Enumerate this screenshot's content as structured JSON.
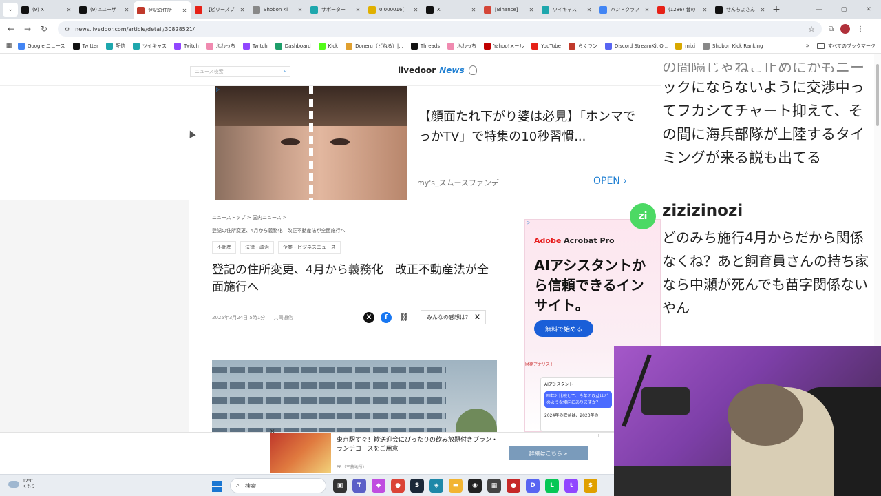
{
  "tabs": [
    {
      "title": "(9) X",
      "icon": "x-icon",
      "color": "#111111",
      "active": false
    },
    {
      "title": "(9) Xユーザ",
      "icon": "x-icon",
      "color": "#111111",
      "active": false
    },
    {
      "title": "登記の住所",
      "icon": "livedoor-icon",
      "color": "#c0392b",
      "active": true
    },
    {
      "title": "【ピリーズブ",
      "icon": "youtube-icon",
      "color": "#e62117",
      "active": false
    },
    {
      "title": "Shobon Ki",
      "icon": "shobon-icon",
      "color": "#888888",
      "active": false
    },
    {
      "title": "サポーター",
      "icon": "twitcasting-icon",
      "color": "#1ea7ad",
      "active": false
    },
    {
      "title": "0.000016(",
      "icon": "coin-icon",
      "color": "#e0b000",
      "active": false
    },
    {
      "title": "X",
      "icon": "x-icon",
      "color": "#111111",
      "active": false
    },
    {
      "title": "[Binance]",
      "icon": "gmail-icon",
      "color": "#d44638",
      "active": false
    },
    {
      "title": "ツイキャス",
      "icon": "twitcasting-icon",
      "color": "#1ea7ad",
      "active": false
    },
    {
      "title": "ハンドクラフ",
      "icon": "google-icon",
      "color": "#4285f4",
      "active": false
    },
    {
      "title": "(1286) 昔の",
      "icon": "youtube-icon",
      "color": "#e62117",
      "active": false
    },
    {
      "title": "せんちょさん",
      "icon": "x-icon",
      "color": "#111111",
      "active": false
    }
  ],
  "toolbar": {
    "url": "news.livedoor.com/article/detail/30828521/"
  },
  "bookmarks": [
    {
      "label": "Google ニュース",
      "icon": "google-news-icon",
      "color": "#4285f4"
    },
    {
      "label": "Twitter",
      "icon": "x-icon",
      "color": "#111111"
    },
    {
      "label": "配信",
      "icon": "twitcasting-icon",
      "color": "#1ea7ad"
    },
    {
      "label": "ツイキャス",
      "icon": "twitcasting-icon",
      "color": "#1ea7ad"
    },
    {
      "label": "Twitch",
      "icon": "twitch-icon",
      "color": "#9146ff"
    },
    {
      "label": "ふわっち",
      "icon": "fuwacchi-icon",
      "color": "#f08ab0"
    },
    {
      "label": "Twitch",
      "icon": "twitch-icon",
      "color": "#9146ff"
    },
    {
      "label": "Dashboard",
      "icon": "dashboard-icon",
      "color": "#1e9e6a"
    },
    {
      "label": "Kick",
      "icon": "kick-icon",
      "color": "#53fc18"
    },
    {
      "label": "Doneru（どねる）|...",
      "icon": "doneru-icon",
      "color": "#e0a030"
    },
    {
      "label": "Threads",
      "icon": "threads-icon",
      "color": "#111111"
    },
    {
      "label": "ふわっち",
      "icon": "fuwacchi-icon",
      "color": "#f08ab0"
    },
    {
      "label": "Yahoo!メール",
      "icon": "yahoo-icon",
      "color": "#c00000"
    },
    {
      "label": "YouTube",
      "icon": "youtube-icon",
      "color": "#e62117"
    },
    {
      "label": "らくラン",
      "icon": "rakuran-icon",
      "color": "#c0392b"
    },
    {
      "label": "Discord StreamKit O...",
      "icon": "discord-icon",
      "color": "#5865f2"
    },
    {
      "label": "mixi",
      "icon": "mixi-icon",
      "color": "#d8a800"
    },
    {
      "label": "Shobon Kick Ranking",
      "icon": "shobon-icon",
      "color": "#888888"
    }
  ],
  "bookmarks_all": "すべてのブックマーク",
  "site": {
    "search_placeholder": "ニュース検索",
    "logo_main": "livedoor",
    "logo_news": "News"
  },
  "top_ad": {
    "headline": "【顔面たれ下がり婆は必見】「ホンマでっかTV」で特集の10秒習慣...",
    "sponsor": "my's_スムースファンデ",
    "open": "OPEN ›"
  },
  "article": {
    "breadcrumb": "ニューストップ > 国内ニュース >",
    "breadcrumb_current": "登記の住所変更、4月から義務化　改正不動産法が全面施行へ",
    "tags": [
      "不動産",
      "法律・政治",
      "企業・ビジネスニュース"
    ],
    "title": "登記の住所変更、4月から義務化　改正不動産法が全面施行へ",
    "date": "2025年3月24日 5時1分",
    "source": "共同通信",
    "share_opinion": "みんなの感想は？"
  },
  "right_ad": {
    "brand_prefix": "Adobe",
    "brand_rest": " Acrobat Pro",
    "headline": "AIアシスタントから信頼できるインサイト。",
    "cta": "無料で始める",
    "analyst": "財務アナリスト",
    "mini_title": "AIアシスタント",
    "mini_bubble": "昨年と比較して、今年の収益はどのような傾向にありますか？",
    "mini_bottom": "2024年の収益は、2023年の"
  },
  "chat": {
    "cut_line": "の間隔じゃねこ止めにかもニー",
    "message1": "ックにならないように交渉中ってフカシてチャート抑えて、その間に海兵部隊が上陸するタイミングが来る説も出てる",
    "avatar_initials": "zi",
    "avatar_color": "#4cd964",
    "username": "zizizinozi",
    "message2": "どのみち施行4月からだから関係なくね？あと飼育員さんの持ち家なら中瀬が死んでも苗字関係ないやん"
  },
  "bottom_ad": {
    "text": "東京駅すぐ！歓送迎会にぴったりの飲み放題付きプラン・ランチコースをご用意",
    "pr": "PR（三菱地所）",
    "button": "詳細はこちら »"
  },
  "taskbar": {
    "temperature": "12°C",
    "weather": "くもり",
    "search_label": "検索",
    "apps": [
      {
        "name": "task-view-icon",
        "color": "#333333",
        "glyph": "▣"
      },
      {
        "name": "teams-icon",
        "color": "#5b5fc7",
        "glyph": "T"
      },
      {
        "name": "copilot-icon",
        "color": "#c04de0",
        "glyph": "◆"
      },
      {
        "name": "chrome-icon",
        "color": "#db4437",
        "glyph": "●"
      },
      {
        "name": "steam-icon",
        "color": "#1b2838",
        "glyph": "S"
      },
      {
        "name": "app-icon",
        "color": "#1e88a8",
        "glyph": "◈"
      },
      {
        "name": "folder-icon",
        "color": "#f2b431",
        "glyph": "▬"
      },
      {
        "name": "obs-icon",
        "color": "#222222",
        "glyph": "◉"
      },
      {
        "name": "calculator-icon",
        "color": "#444444",
        "glyph": "▦"
      },
      {
        "name": "record-icon",
        "color": "#c62828",
        "glyph": "●"
      },
      {
        "name": "discord-icon",
        "color": "#5865f2",
        "glyph": "D"
      },
      {
        "name": "line-icon",
        "color": "#06c755",
        "glyph": "L"
      },
      {
        "name": "twitch-icon",
        "color": "#9146ff",
        "glyph": "t"
      },
      {
        "name": "coin-icon",
        "color": "#e0a000",
        "glyph": "$"
      }
    ]
  }
}
